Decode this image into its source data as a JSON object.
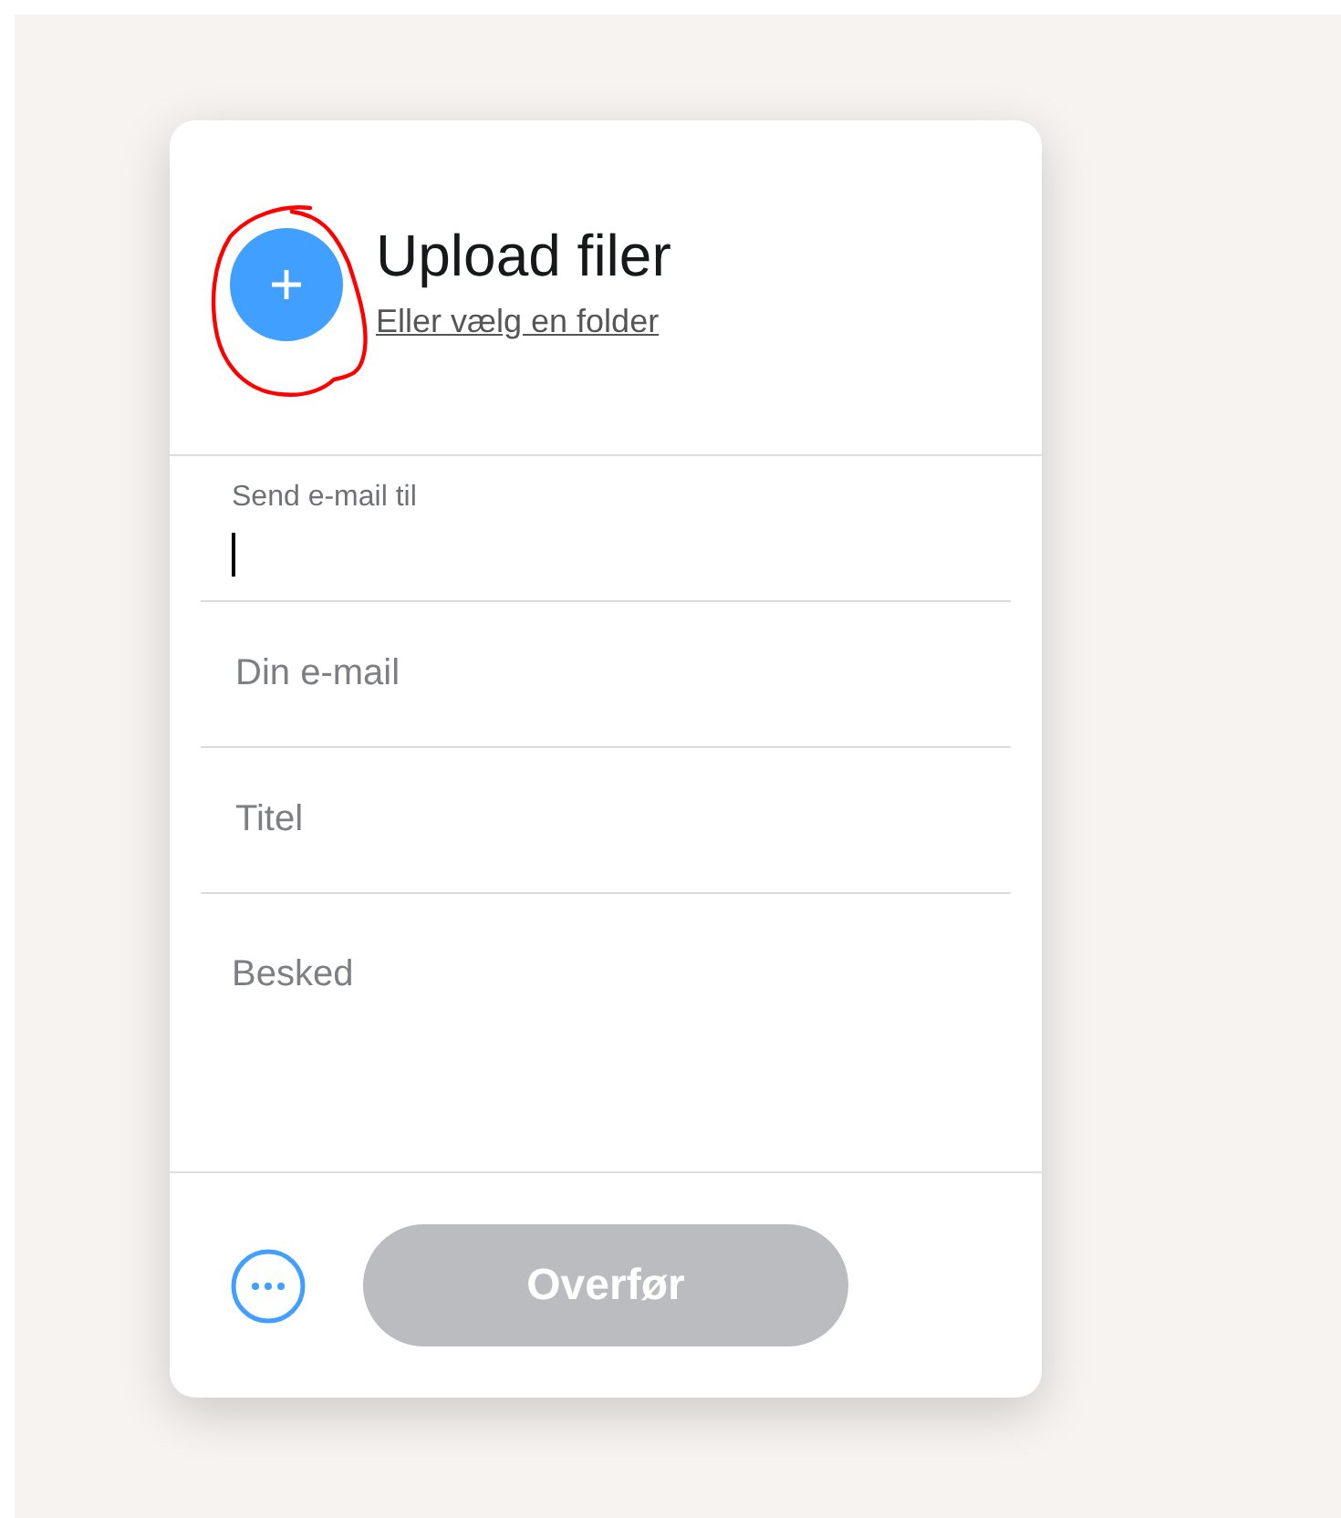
{
  "upload": {
    "title": "Upload filer",
    "link": "Eller vælg en folder"
  },
  "fields": [
    {
      "kind": "input",
      "label": "Send e-mail til",
      "focused": true
    },
    {
      "kind": "input",
      "placeholder": "Din e-mail",
      "focused": false
    },
    {
      "kind": "input",
      "placeholder": "Titel",
      "focused": false
    },
    {
      "kind": "textarea",
      "placeholder": "Besked",
      "focused": false
    }
  ],
  "transfer_button": {
    "label": "Overfør",
    "disabled": true
  }
}
